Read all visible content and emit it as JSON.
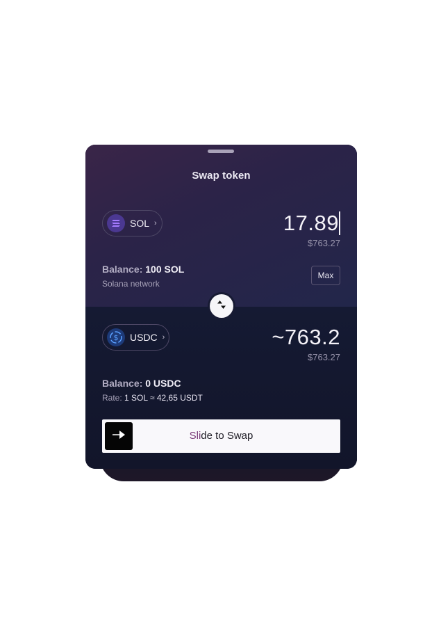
{
  "sheet": {
    "title": "Swap token"
  },
  "from": {
    "token": "SOL",
    "token_icon": "solana-icon",
    "amount": "17.89",
    "fiat": "$763.27",
    "balance_label": "Balance:",
    "balance_value": "100 SOL",
    "network": "Solana network",
    "max_label": "Max"
  },
  "to": {
    "token": "USDC",
    "token_icon": "usdc-icon",
    "amount": "~763.2",
    "fiat": "$763.27",
    "balance_label": "Balance:",
    "balance_value": "0 USDC",
    "rate_label": "Rate:",
    "rate_value": "1 SOL ≈ 42,65 USDT"
  },
  "slider": {
    "label_first": "Sli",
    "label_rest": "de to Swap",
    "thumb_icon": "arrow-right-icon"
  },
  "colors": {
    "top_gradient": "#3a2548",
    "bottom_bg": "#12152a",
    "solana_accent": "#9b6cf5",
    "usdc_accent": "#3d8ae6"
  }
}
